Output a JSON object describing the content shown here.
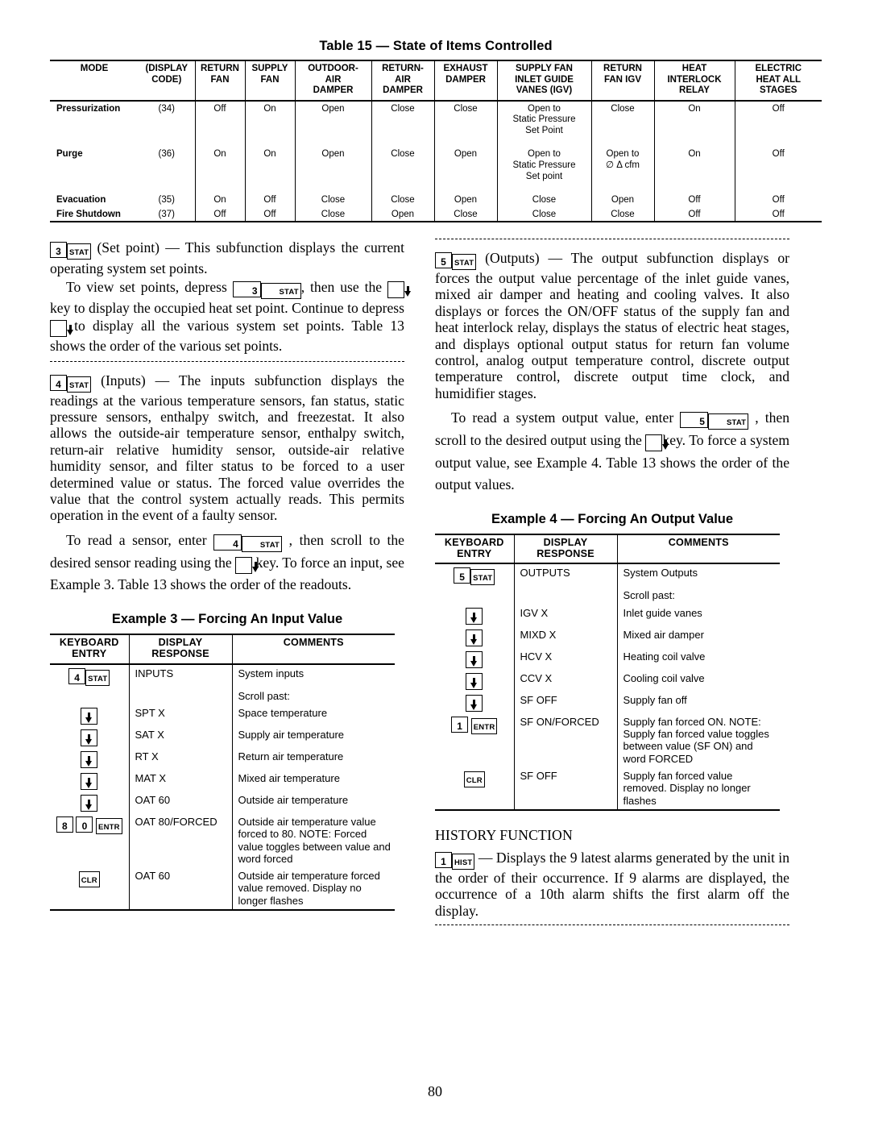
{
  "page": {
    "number": "80"
  },
  "table15": {
    "title": "Table 15 — State of Items Controlled",
    "headers": [
      "MODE",
      "(DISPLAY CODE)",
      "RETURN FAN",
      "SUPPLY FAN",
      "OUTDOOR- AIR DAMPER",
      "RETURN- AIR DAMPER",
      "EXHAUST DAMPER",
      "SUPPLY FAN INLET GUIDE VANES (IGV)",
      "RETURN FAN IGV",
      "HEAT INTERLOCK RELAY",
      "ELECTRIC HEAT ALL STAGES"
    ],
    "headers_lines": {
      "mode": [
        "MODE"
      ],
      "display_code": [
        "(DISPLAY",
        "CODE)"
      ],
      "return_fan": [
        "RETURN",
        "FAN"
      ],
      "supply_fan": [
        "SUPPLY",
        "FAN"
      ],
      "outdoor_air_damper": [
        "OUTDOOR-",
        "AIR",
        "DAMPER"
      ],
      "return_air_damper": [
        "RETURN-",
        "AIR",
        "DAMPER"
      ],
      "exhaust_damper": [
        "EXHAUST",
        "DAMPER"
      ],
      "supply_fan_igv": [
        "SUPPLY FAN",
        "INLET GUIDE",
        "VANES (IGV)"
      ],
      "return_fan_igv": [
        "RETURN",
        "FAN IGV"
      ],
      "heat_interlock_relay": [
        "HEAT",
        "INTERLOCK",
        "RELAY"
      ],
      "electric_heat_all_stages": [
        "ELECTRIC",
        "HEAT ALL",
        "STAGES"
      ]
    },
    "rows": [
      {
        "mode": "Pressurization",
        "code": "(34)",
        "return_fan": "Off",
        "supply_fan": "On",
        "outdoor_air_damper": "Open",
        "return_air_damper": "Close",
        "exhaust_damper": "Close",
        "supply_fan_igv": "Open to Static Pressure Set Point",
        "return_fan_igv": "Close",
        "heat_interlock_relay": "On",
        "electric_heat": "Off"
      },
      {
        "mode": "Purge",
        "code": "(36)",
        "return_fan": "On",
        "supply_fan": "On",
        "outdoor_air_damper": "Open",
        "return_air_damper": "Close",
        "exhaust_damper": "Open",
        "supply_fan_igv": "Open to Static Pressure Set point",
        "return_fan_igv": "Open to ∅ Δ cfm",
        "heat_interlock_relay": "On",
        "electric_heat": "Off"
      },
      {
        "mode": "Evacuation",
        "code": "(35)",
        "return_fan": "On",
        "supply_fan": "Off",
        "outdoor_air_damper": "Close",
        "return_air_damper": "Close",
        "exhaust_damper": "Open",
        "supply_fan_igv": "Close",
        "return_fan_igv": "Open",
        "heat_interlock_relay": "Off",
        "electric_heat": "Off"
      },
      {
        "mode": "Fire Shutdown",
        "code": "(37)",
        "return_fan": "Off",
        "supply_fan": "Off",
        "outdoor_air_damper": "Close",
        "return_air_damper": "Open",
        "exhaust_damper": "Close",
        "supply_fan_igv": "Close",
        "return_fan_igv": "Close",
        "heat_interlock_relay": "Off",
        "electric_heat": "Off"
      }
    ]
  },
  "left_column": {
    "setpoint": {
      "key_num": "3",
      "key_lbl": "STAT",
      "para1_a": "(Set point) — This subfunction displays the current operating system set points.",
      "para2_a": "To view set points, depress",
      "para2_b": ", then use the",
      "para2_c": "key to display the occupied heat set point. Continue to depress",
      "para2_d": "to display all the various system set points. Table 13 shows the order of the various set points."
    },
    "inputs": {
      "key_num": "4",
      "key_lbl": "STAT",
      "para1_a": "(Inputs) — The inputs subfunction displays the readings at the various temperature sensors, fan status, static pressure sensors, enthalpy switch, and freezestat. It also allows the outside-air temperature sensor, enthalpy switch, return-air relative humidity sensor, outside-air relative humidity sensor, and filter status to be forced to a user determined value or status. The forced value overrides the value that the control system actually reads. This permits operation in the event of a faulty sensor.",
      "para2_a": "To read a sensor, enter",
      "para2_b": ", then scroll to the desired sensor reading using the",
      "para2_c": "key. To force an input, see Example 3. Table 13 shows the order of the readouts."
    },
    "example3": {
      "title": "Example 3 — Forcing An Input Value",
      "headers": {
        "c1_l1": "KEYBOARD",
        "c1_l2": "ENTRY",
        "c2_l1": "DISPLAY",
        "c2_l2": "RESPONSE",
        "c3": "COMMENTS"
      },
      "rows": [
        {
          "keys": [
            {
              "type": "num",
              "label": "4"
            },
            {
              "type": "lbl",
              "label": "STAT"
            }
          ],
          "display": "INPUTS",
          "comment": "System inputs"
        },
        {
          "keys": [],
          "display": "",
          "comment": "Scroll past:"
        },
        {
          "keys": [
            {
              "type": "arrow",
              "label": "down"
            }
          ],
          "display": "SPT X",
          "comment": "Space temperature"
        },
        {
          "keys": [
            {
              "type": "arrow",
              "label": "down"
            }
          ],
          "display": "SAT X",
          "comment": "Supply air temperature"
        },
        {
          "keys": [
            {
              "type": "arrow",
              "label": "down"
            }
          ],
          "display": "RT X",
          "comment": "Return air temperature"
        },
        {
          "keys": [
            {
              "type": "arrow",
              "label": "down"
            }
          ],
          "display": "MAT X",
          "comment": "Mixed air temperature"
        },
        {
          "keys": [
            {
              "type": "arrow",
              "label": "down"
            }
          ],
          "display": "OAT 60",
          "comment": "Outside air temperature"
        },
        {
          "keys": [
            {
              "type": "num",
              "label": "8"
            },
            {
              "type": "num",
              "label": "0"
            },
            {
              "type": "lbl",
              "label": "ENTR"
            }
          ],
          "display": "OAT 80/FORCED",
          "comment": "Outside air temperature value forced to 80. NOTE: Forced value toggles between value and word forced"
        },
        {
          "keys": [
            {
              "type": "lbl",
              "label": "CLR"
            }
          ],
          "display": "OAT 60",
          "comment": "Outside air temperature forced value removed. Display no longer flashes"
        }
      ]
    }
  },
  "right_column": {
    "outputs": {
      "key_num": "5",
      "key_lbl": "STAT",
      "para1_a": "(Outputs) — The output subfunction displays or forces the output value percentage of the inlet guide vanes, mixed air damper and heating and cooling valves. It also displays or forces the ON/OFF status of the supply fan and heat interlock relay, displays the status of electric heat stages, and displays optional output status for return fan volume control, analog output temperature control, discrete output temperature control, discrete output time clock, and humidifier stages.",
      "para2_a": "To read a system output value, enter",
      "para2_b": ", then scroll to the desired output using the",
      "para2_c": "key. To force a system output value, see Example 4. Table 13 shows the order of the output values."
    },
    "example4": {
      "title": "Example 4 — Forcing An Output Value",
      "headers": {
        "c1_l1": "KEYBOARD",
        "c1_l2": "ENTRY",
        "c2_l1": "DISPLAY",
        "c2_l2": "RESPONSE",
        "c3": "COMMENTS"
      },
      "rows": [
        {
          "keys": [
            {
              "type": "num",
              "label": "5"
            },
            {
              "type": "lbl",
              "label": "STAT"
            }
          ],
          "display": "OUTPUTS",
          "comment": "System Outputs"
        },
        {
          "keys": [],
          "display": "",
          "comment": "Scroll past:"
        },
        {
          "keys": [
            {
              "type": "arrow",
              "label": "down"
            }
          ],
          "display": "IGV X",
          "comment": "Inlet guide vanes"
        },
        {
          "keys": [
            {
              "type": "arrow",
              "label": "down"
            }
          ],
          "display": "MIXD X",
          "comment": "Mixed air damper"
        },
        {
          "keys": [
            {
              "type": "arrow",
              "label": "down"
            }
          ],
          "display": "HCV X",
          "comment": "Heating coil valve"
        },
        {
          "keys": [
            {
              "type": "arrow",
              "label": "down"
            }
          ],
          "display": "CCV X",
          "comment": "Cooling coil valve"
        },
        {
          "keys": [
            {
              "type": "arrow",
              "label": "down"
            }
          ],
          "display": "SF OFF",
          "comment": "Supply fan off"
        },
        {
          "keys": [
            {
              "type": "num",
              "label": "1"
            },
            {
              "type": "lbl",
              "label": "ENTR"
            }
          ],
          "display": "SF ON/FORCED",
          "comment": "Supply fan forced ON. NOTE: Supply fan forced value toggles between value (SF ON) and word FORCED"
        },
        {
          "keys": [
            {
              "type": "lbl",
              "label": "CLR"
            }
          ],
          "display": "SF OFF",
          "comment": "Supply fan forced value removed. Display no longer flashes"
        }
      ]
    },
    "history": {
      "heading": "HISTORY FUNCTION",
      "key_num": "1",
      "key_lbl": "HIST",
      "para_a": "— Displays the 9 latest alarms generated by the unit in the order of their occurrence. If 9 alarms are displayed, the occurrence of a 10th alarm shifts the first alarm off the display."
    }
  }
}
